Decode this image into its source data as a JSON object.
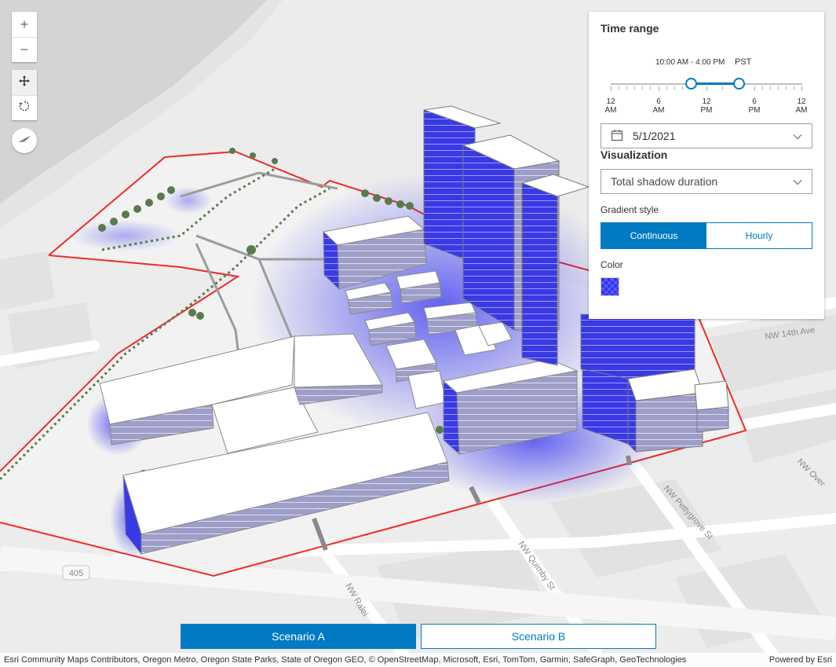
{
  "navigation": {
    "zoom_in": "+",
    "zoom_out": "−",
    "pan_icon": "pan-icon",
    "rotate_icon": "rotate-icon",
    "compass_icon": "compass-icon"
  },
  "shadow_panel": {
    "time_range_title": "Time range",
    "time_range_value": "10:00 AM - 4:00 PM",
    "timezone": "PST",
    "slider_start_hour": 10,
    "slider_end_hour": 16,
    "ticks": [
      {
        "line1": "12",
        "line2": "AM"
      },
      {
        "line1": "6",
        "line2": "AM"
      },
      {
        "line1": "12",
        "line2": "PM"
      },
      {
        "line1": "6",
        "line2": "PM"
      },
      {
        "line1": "12",
        "line2": "AM"
      }
    ],
    "date": "5/1/2021",
    "visualization_title": "Visualization",
    "visualization_value": "Total shadow duration",
    "gradient_label": "Gradient style",
    "gradient_options": [
      "Continuous",
      "Hourly"
    ],
    "gradient_selected": "Continuous",
    "color_label": "Color",
    "color_value": "#3333ee"
  },
  "scenarios": {
    "a": "Scenario A",
    "b": "Scenario B",
    "selected": "Scenario A"
  },
  "map_labels": {
    "highway": "405",
    "quimby": "NW Quimby St",
    "pettygrove": "NW Pettygrove St",
    "raleigh": "NW Ralei",
    "overton": "NW Over",
    "fourteenth": "NW 14th Ave"
  },
  "attribution": {
    "sources": "Esri Community Maps Contributors, Oregon Metro, Oregon State Parks, State of Oregon GEO, © OpenStreetMap, Microsoft, Esri, TomTom, Garmin, SafeGraph, GeoTechnologies",
    "powered_by": "Powered by Esri"
  },
  "colors": {
    "accent": "#007ac2",
    "shadow": "#3333ee",
    "boundary": "#ee2a2a"
  }
}
